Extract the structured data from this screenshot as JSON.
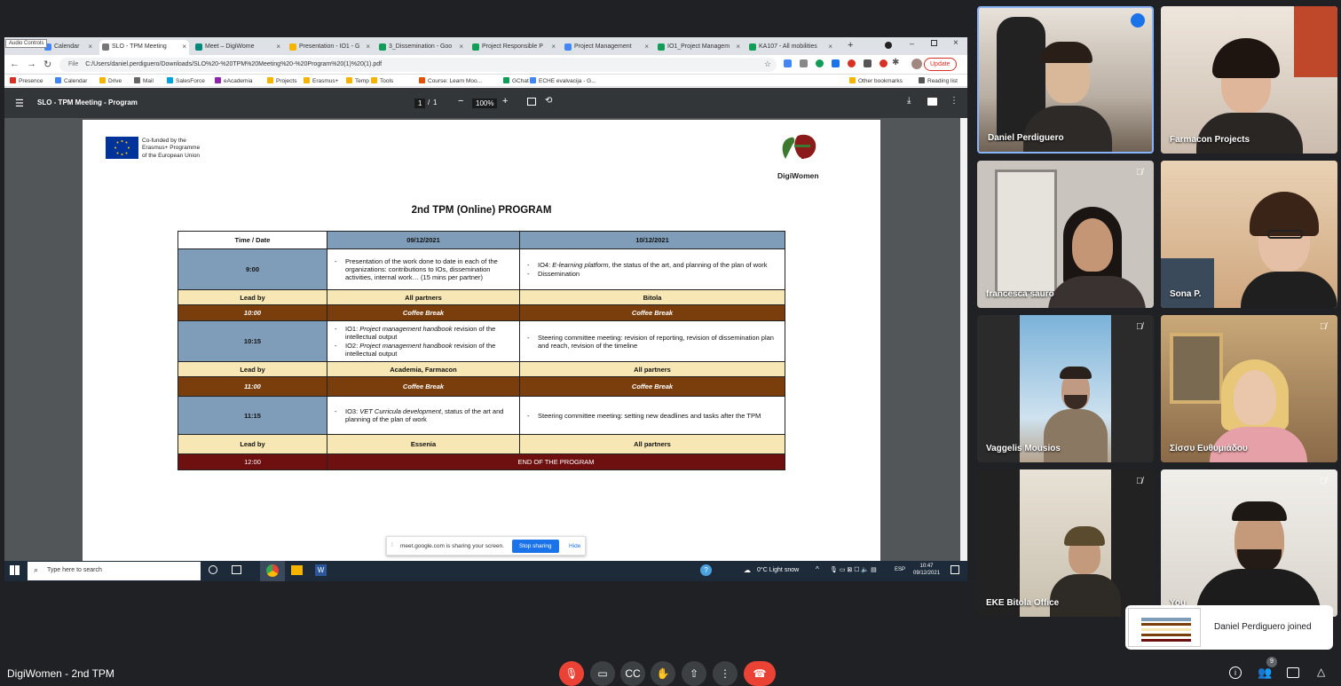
{
  "browser": {
    "tabs": [
      {
        "label": "Calendar",
        "icon_color": "#4285f4"
      },
      {
        "label": "SLO - TPM Meeting",
        "icon_color": "#777777",
        "active": true
      },
      {
        "label": "Meet – DigiWome",
        "icon_color": "#00897b"
      },
      {
        "label": "Presentation - IO1 - G",
        "icon_color": "#f4b400"
      },
      {
        "label": "3_Dissemination - Goo",
        "icon_color": "#0f9d58"
      },
      {
        "label": "Project Responsible P",
        "icon_color": "#0f9d58"
      },
      {
        "label": "Project Management",
        "icon_color": "#4285f4"
      },
      {
        "label": "IO1_Project Managem",
        "icon_color": "#0f9d58"
      },
      {
        "label": "KA107 - All mobilities",
        "icon_color": "#0f9d58"
      }
    ],
    "audio_controls_tooltip": "Audio Controls",
    "file_label": "File",
    "url": "C:/Users/daniel.perdiguero/Downloads/SLO%20-%20TPM%20Meeting%20-%20Program%20(1)%20(1).pdf",
    "update_label": "Update",
    "bookmarks": [
      {
        "label": "Presence",
        "icon_color": "#d93025"
      },
      {
        "label": "Calendar",
        "icon_color": "#4285f4"
      },
      {
        "label": "Drive",
        "icon_color": "#f4b400"
      },
      {
        "label": "Mail",
        "icon_color": "#666666"
      },
      {
        "label": "SalesForce",
        "icon_color": "#00a1e0"
      },
      {
        "label": "eAcademia",
        "icon_color": "#8e24aa"
      },
      {
        "label": "Projects",
        "icon_color": "#f4b400"
      },
      {
        "label": "Erasmus+",
        "icon_color": "#f4b400"
      },
      {
        "label": "Temp",
        "icon_color": "#f4b400"
      },
      {
        "label": "Tools",
        "icon_color": "#f4b400"
      },
      {
        "label": "Course: Learn Moo...",
        "icon_color": "#e65100"
      },
      {
        "label": "GChat",
        "icon_color": "#0f9d58"
      },
      {
        "label": "ECHE evalvacija - G...",
        "icon_color": "#4285f4"
      }
    ],
    "other_bookmarks": "Other bookmarks",
    "reading_list": "Reading list"
  },
  "pdf": {
    "title": "SLO - TPM Meeting - Program",
    "page_current": "1",
    "page_total": "1",
    "zoom": "100%"
  },
  "doc": {
    "eu_text_1": "Co-funded by the",
    "eu_text_2": "Erasmus+ Programme",
    "eu_text_3": "of the European Union",
    "logo_text": "DigiWomen",
    "heading": "2nd TPM (Online) PROGRAM",
    "header_time": "Time / Date",
    "day1": "09/12/2021",
    "day2": "10/12/2021",
    "slot1_time": "9:00",
    "slot1_day1": "Presentation of the work done to date in each of the organizations: contributions to IOs, dissemination activities, internal work… (15 mins per partner)",
    "slot1_day2_a_prefix": "IO4: ",
    "slot1_day2_a_italic": "E-learning platform",
    "slot1_day2_a_rest": ", the status of the art, and planning of the plan of work",
    "slot1_day2_b": "Dissemination",
    "lead_label": "Lead by",
    "lead1_day1": "All partners",
    "lead1_day2": "Bitola",
    "break1_time": "10:00",
    "coffee": "Coffee Break",
    "slot2_time": "10:15",
    "slot2_day1_a_prefix": "IO1: ",
    "slot2_day1_a_italic": "Project management handbook",
    "slot2_day1_a_rest": " revision of the intellectual output",
    "slot2_day1_b_prefix": "IO2: ",
    "slot2_day1_b_italic": "Project management handbook",
    "slot2_day1_b_rest": " revision of the intellectual output",
    "slot2_day2": "Steering committee meeting: revision of reporting, revision of dissemination plan and reach, revision of the timeline",
    "lead2_day1": "Academia, Farmacon",
    "lead2_day2": "All partners",
    "break2_time": "11:00",
    "slot3_time": "11:15",
    "slot3_day1_prefix": "IO3: ",
    "slot3_day1_italic": "VET Curricula development",
    "slot3_day1_rest": ", status of the art and planning of the plan of work",
    "slot3_day2": "Steering committee meeting: setting new deadlines and tasks after the TPM",
    "lead3_day1": "Essenia",
    "lead3_day2": "All partners",
    "end_time": "12:00",
    "end_text": "END OF THE PROGRAM"
  },
  "sharebar": {
    "text": "meet.google.com is sharing your screen.",
    "stop": "Stop sharing",
    "hide": "Hide"
  },
  "taskbar": {
    "search_placeholder": "Type here to search",
    "weather": "0°C  Light snow",
    "lang": "ESP",
    "time": "10:47",
    "date": "09/12/2021"
  },
  "participants": [
    {
      "name": "Daniel Perdiguero"
    },
    {
      "name": "Farmacon Projects"
    },
    {
      "name": "francesca sauro"
    },
    {
      "name": "Sona P."
    },
    {
      "name": "Vaggelis Mousios"
    },
    {
      "name": "Σίσσυ Ευθυμιάδου"
    },
    {
      "name": "EKE Bitola Office"
    },
    {
      "name": "You"
    }
  ],
  "meeting": {
    "name": "DigiWomen - 2nd TPM",
    "participant_count": "9",
    "toast": "Daniel Perdiguero joined"
  },
  "colors": {
    "slot_blue": "#7f9db8",
    "lead_yellow": "#f6e7b4",
    "break_brown": "#7a3e0c",
    "end_red": "#6e1010",
    "leave_red": "#ea4335"
  }
}
